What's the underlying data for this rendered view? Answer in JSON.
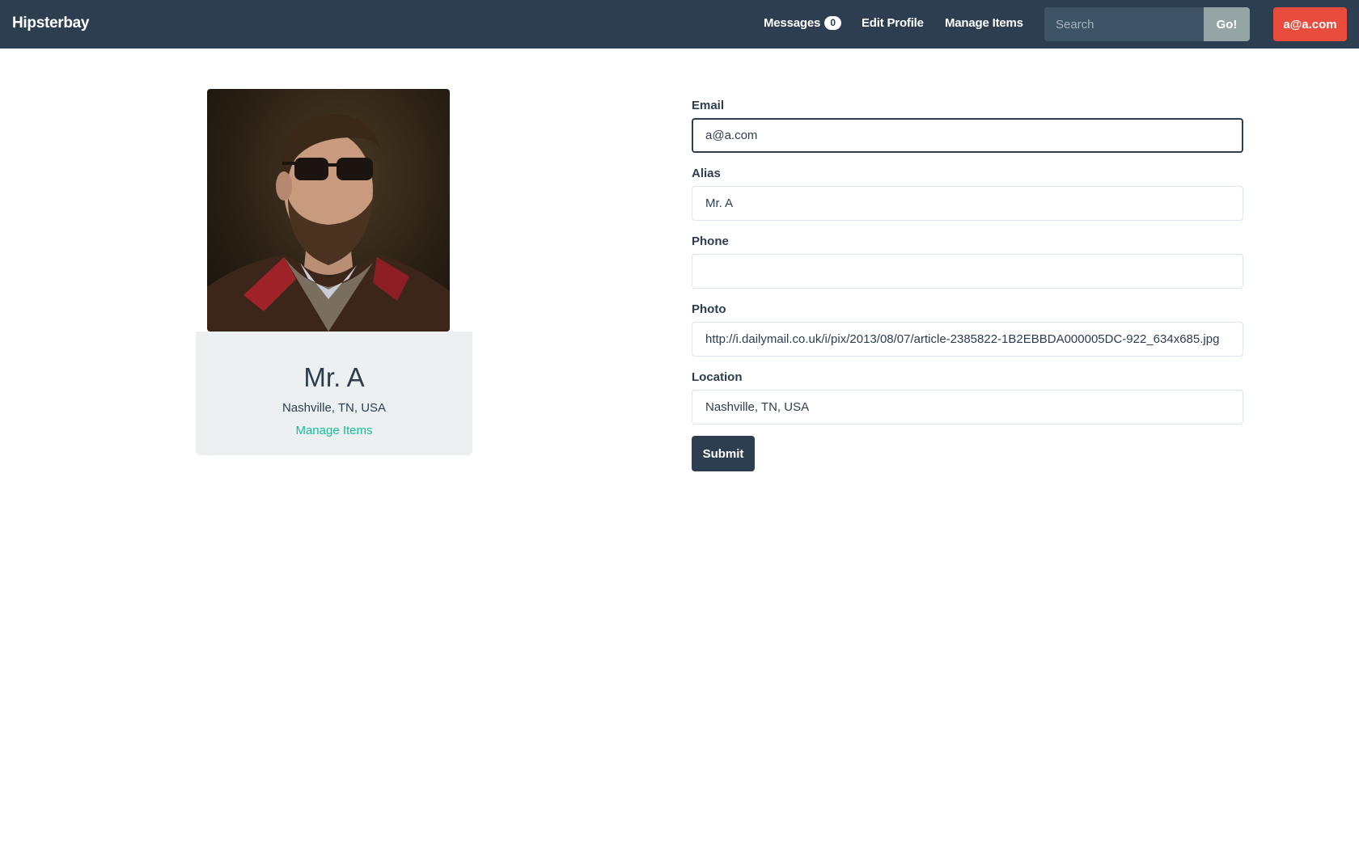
{
  "navbar": {
    "brand": "Hipsterbay",
    "messages_label": "Messages",
    "messages_count": "0",
    "edit_profile_label": "Edit Profile",
    "manage_items_label": "Manage Items",
    "search_placeholder": "Search",
    "search_value": "",
    "go_label": "Go!",
    "account_label": "a@a.com"
  },
  "profile": {
    "name": "Mr. A",
    "location": "Nashville, TN, USA",
    "manage_items_link": "Manage Items"
  },
  "form": {
    "email": {
      "label": "Email",
      "value": "a@a.com"
    },
    "alias": {
      "label": "Alias",
      "value": "Mr. A"
    },
    "phone": {
      "label": "Phone",
      "value": ""
    },
    "photo": {
      "label": "Photo",
      "value": "http://i.dailymail.co.uk/i/pix/2013/08/07/article-2385822-1B2EBBDA000005DC-922_634x685.jpg"
    },
    "location": {
      "label": "Location",
      "value": "Nashville, TN, USA"
    },
    "submit_label": "Submit"
  },
  "colors": {
    "navbar_bg": "#2c3e50",
    "accent_green": "#18bc9c",
    "danger_red": "#e74c3c",
    "muted_gray": "#95a5a6",
    "card_bg": "#ecf0f1"
  },
  "icons": {
    "profile_photo": "portrait-image"
  }
}
